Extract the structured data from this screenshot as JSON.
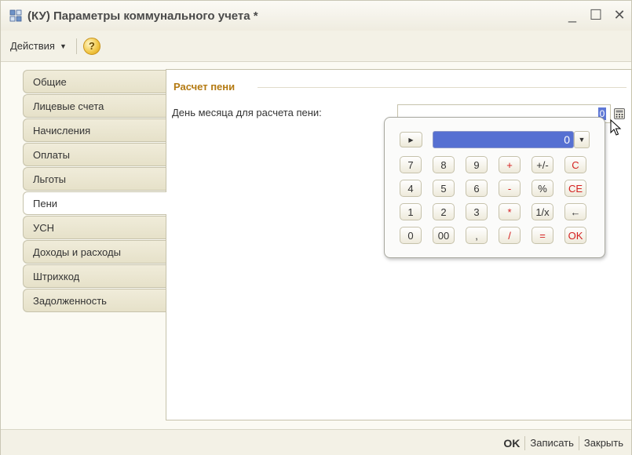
{
  "window": {
    "title": "(КУ) Параметры коммунального учета *",
    "controls": {
      "minimize": "_",
      "maximize": "☐",
      "close": "✕"
    }
  },
  "toolbar": {
    "actions_label": "Действия",
    "help_label": "?"
  },
  "tabs": [
    {
      "label": "Общие",
      "active": false
    },
    {
      "label": "Лицевые счета",
      "active": false
    },
    {
      "label": "Начисления",
      "active": false
    },
    {
      "label": "Оплаты",
      "active": false
    },
    {
      "label": "Льготы",
      "active": false
    },
    {
      "label": "Пени",
      "active": true
    },
    {
      "label": "УСН",
      "active": false
    },
    {
      "label": "Доходы и расходы",
      "active": false
    },
    {
      "label": "Штрихкод",
      "active": false
    },
    {
      "label": "Задолженность",
      "active": false
    }
  ],
  "section": {
    "title": "Расчет пени",
    "field_label": "День месяца для расчета пени:",
    "field_value": "0"
  },
  "calculator": {
    "display_value": "0",
    "keys": [
      [
        "7",
        "8",
        "9",
        "+",
        "+/-",
        "C"
      ],
      [
        "4",
        "5",
        "6",
        "-",
        "%",
        "CE"
      ],
      [
        "1",
        "2",
        "3",
        "*",
        "1/x",
        "←"
      ],
      [
        "0",
        "00",
        ",",
        "/",
        "=",
        "OK"
      ]
    ]
  },
  "footer": {
    "ok": "OK",
    "save": "Записать",
    "close": "Закрыть"
  },
  "colors": {
    "accent_title": "#b47a12",
    "display_bg": "#5670d2",
    "key_red": "#d42020"
  }
}
